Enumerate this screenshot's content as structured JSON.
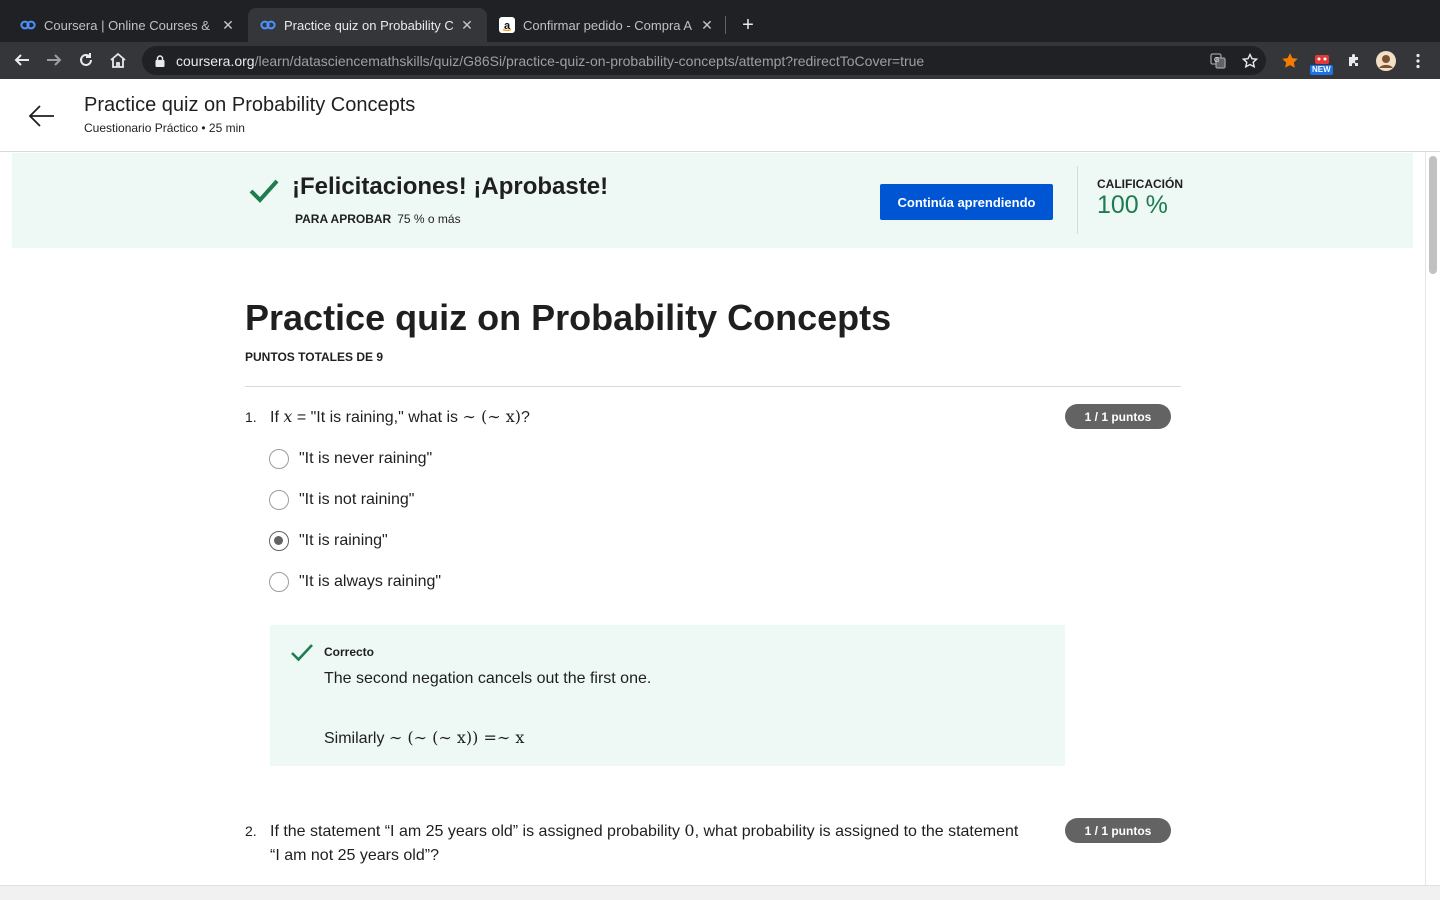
{
  "browser": {
    "tabs": [
      {
        "title": "Coursera | Online Courses & Cr",
        "favicon": "coursera-icon",
        "active": false
      },
      {
        "title": "Practice quiz on Probability Co",
        "favicon": "coursera-icon",
        "active": true
      },
      {
        "title": "Confirmar pedido - Compra Am",
        "favicon": "amazon-icon",
        "active": false
      }
    ],
    "url_host": "coursera.org",
    "url_path": "/learn/datasciencemathskills/quiz/G86Si/practice-quiz-on-probability-concepts/attempt?redirectToCover=true",
    "extension_badge": "NEW"
  },
  "header": {
    "title": "Practice quiz on Probability Concepts",
    "subtitle": "Cuestionario Práctico • 25 min"
  },
  "banner": {
    "title": "¡Felicitaciones! ¡Aprobaste!",
    "pass_label": "PARA APROBAR",
    "pass_value": "75 % o más",
    "continue_label": "Continúa aprendiendo",
    "grade_label": "CALIFICACIÓN",
    "grade_value": "100 %"
  },
  "quiz": {
    "title": "Practice quiz on Probability Concepts",
    "total_points": "PUNTOS TOTALES DE 9",
    "questions": [
      {
        "number": "1.",
        "text_a": "If ",
        "math_a": "x",
        "text_b": " = \"It is raining,\" what is ",
        "math_b": "∼ (∼ x)",
        "text_c": "?",
        "points": "1 / 1 puntos",
        "options": [
          {
            "label": "\"It is never raining\"",
            "selected": false
          },
          {
            "label": "\"It is not raining\"",
            "selected": false
          },
          {
            "label": "\"It is raining\"",
            "selected": true
          },
          {
            "label": "\"It is always raining\"",
            "selected": false
          }
        ],
        "feedback": {
          "title": "Correcto",
          "text": "The second negation cancels out the first one.",
          "text2_prefix": "Similarly ",
          "text2_math": "∼ (∼ (∼ x)) =∼ x"
        }
      },
      {
        "number": "2.",
        "text_a": "If the statement “I am 25 years old” is assigned probability ",
        "math_a": "0",
        "text_b": ", what probability is assigned to the statement",
        "text_line2": "“I am not 25 years old”?",
        "points": "1 / 1 puntos"
      }
    ]
  },
  "colors": {
    "brand_blue": "#0056d2",
    "success_green": "#1d7c50",
    "success_bg": "#eef8f4",
    "badge_gray": "#636363"
  }
}
